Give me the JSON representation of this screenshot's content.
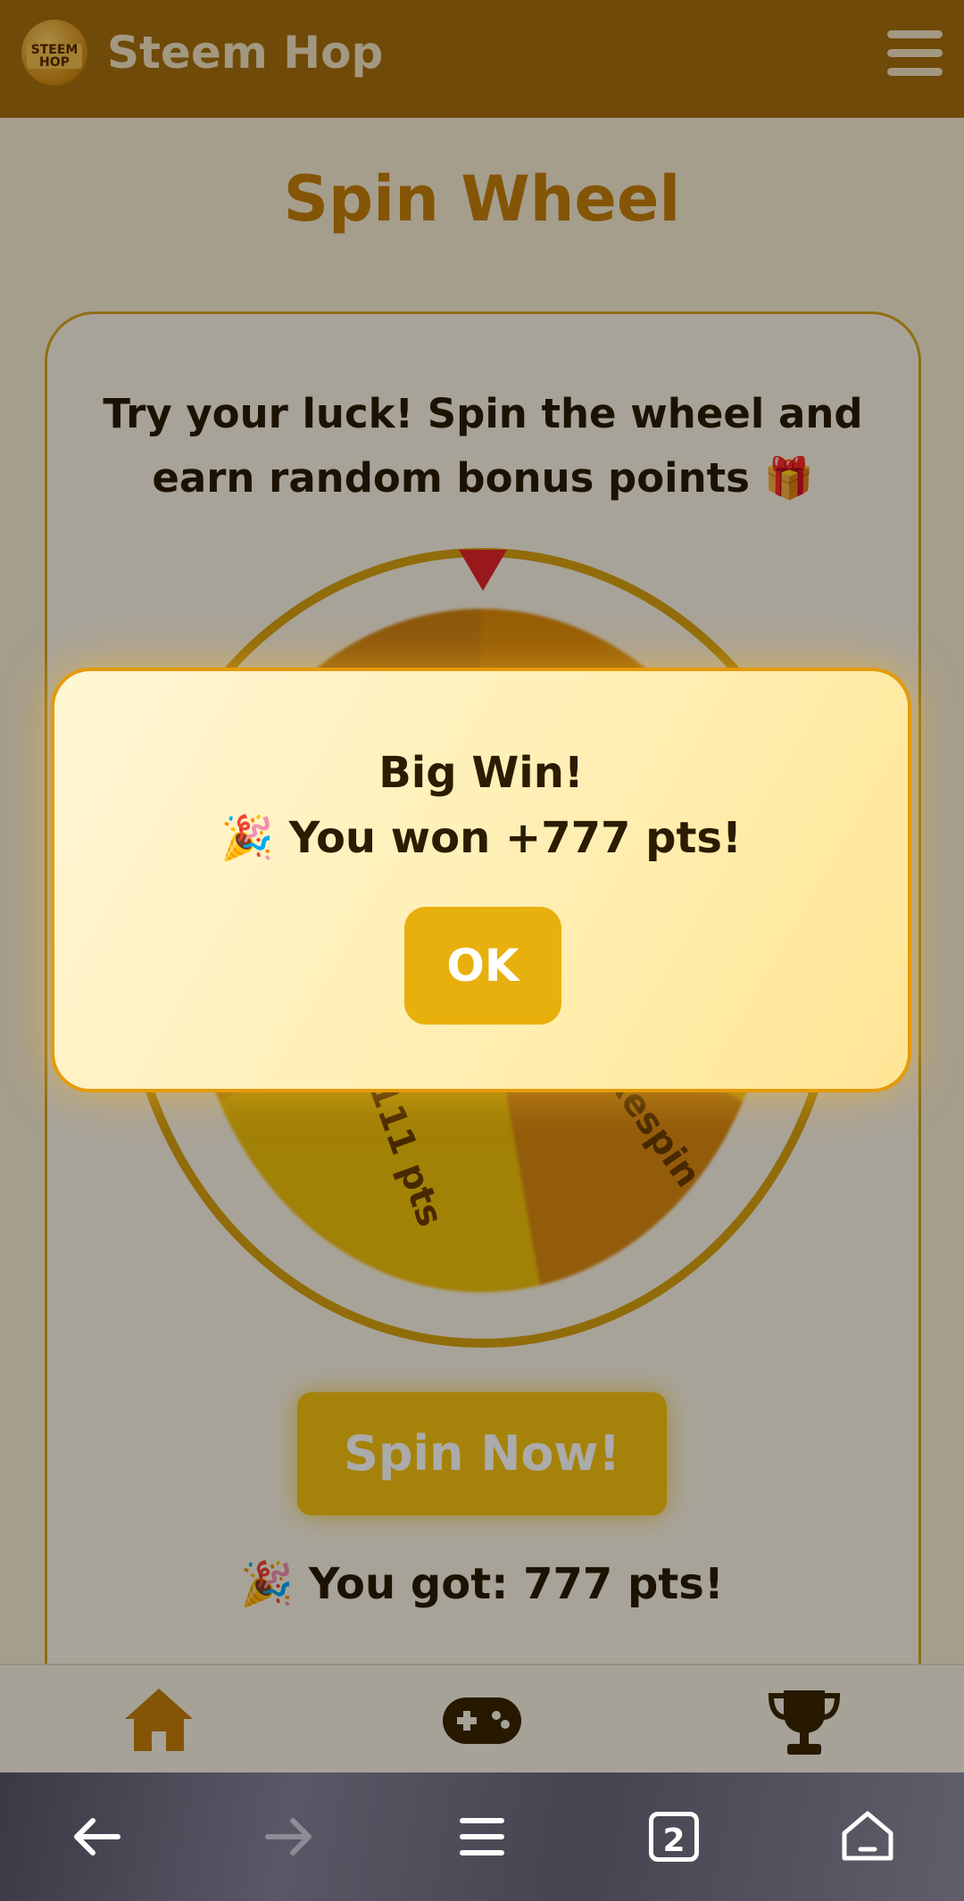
{
  "app": {
    "title": "Steem Hop",
    "logo_text": "STEEM HOP"
  },
  "page": {
    "title": "Spin Wheel",
    "description": "Try your luck! Spin the wheel and earn random bonus points 🎁"
  },
  "wheel": {
    "labels": [
      "111 pts",
      "Respin"
    ]
  },
  "spin_button": {
    "label": "Spin Now!"
  },
  "result": {
    "text": "🎉 You got: 777 pts!"
  },
  "modal": {
    "title": "Big Win!",
    "message": "🎉 You won +777 pts!",
    "ok_label": "OK"
  },
  "bottom_nav": {
    "items": [
      {
        "icon": "home-icon"
      },
      {
        "icon": "gamepad-icon"
      },
      {
        "icon": "trophy-icon"
      }
    ]
  },
  "browser_bar": {
    "tab_count": "2"
  },
  "colors": {
    "header": "#a86f0d",
    "accent": "#e8b00d",
    "title": "#c57f0a"
  }
}
